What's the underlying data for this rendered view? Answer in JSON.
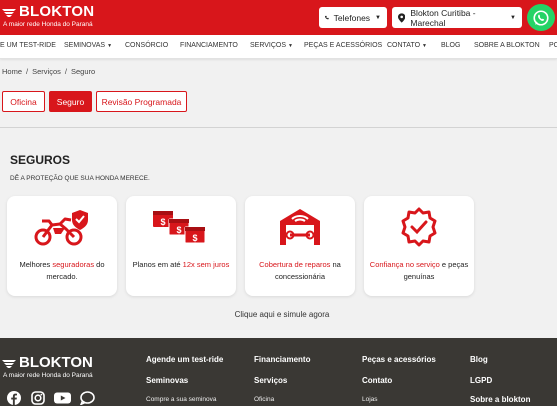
{
  "header": {
    "logo_text": "BLOKTON",
    "logo_tagline": "A maior rede Honda do Paraná",
    "phone_label": "Telefones",
    "store_label": "Blokton Curitiba - Marechal"
  },
  "nav": {
    "items": [
      "E UM TEST-RIDE",
      "SEMINOVAS",
      "CONSÓRCIO",
      "FINANCIAMENTO",
      "SERVIÇOS",
      "PEÇAS E ACESSÓRIOS",
      "CONTATO",
      "BLOG",
      "SOBRE A BLOKTON",
      "PO"
    ]
  },
  "breadcrumb": {
    "home": "Home",
    "services": "Serviços",
    "current": "Seguro",
    "separator": "/"
  },
  "tabs": [
    "Oficina",
    "Seguro",
    "Revisão Programada"
  ],
  "section": {
    "title": "SEGUROS",
    "subtitle": "DÊ A PROTEÇÃO QUE SUA HONDA MERECE."
  },
  "cards": [
    {
      "pre": "Melhores ",
      "red": "seguradoras",
      "post": " do mercado."
    },
    {
      "pre": "Planos em até ",
      "red": "12x sem juros",
      "post": ""
    },
    {
      "pre": "",
      "red": "Cobertura de reparos",
      "post": " na concessionária"
    },
    {
      "pre": "",
      "red": "Confiança no serviço",
      "post": " e peças genuínas"
    }
  ],
  "cta": "Clique aqui e simule agora",
  "footer": {
    "logo_text": "BLOKTON",
    "logo_tagline": "A maior rede Honda do Paraná",
    "col1_a": "Agende um test-ride",
    "col1_b": "Seminovas",
    "col1_c": "Compre a sua seminova",
    "col2_a": "Financiamento",
    "col2_b": "Serviços",
    "col2_c": "Oficina",
    "col3_a": "Peças e acessórios",
    "col3_b": "Contato",
    "col3_c": "Lojas",
    "col4_a": "Blog",
    "col4_b": "LGPD",
    "col4_c": "Sobre a blokton"
  },
  "colors": {
    "brand_red": "#d8161b",
    "footer_bg": "#3a3834",
    "whatsapp_green": "#25d366"
  }
}
